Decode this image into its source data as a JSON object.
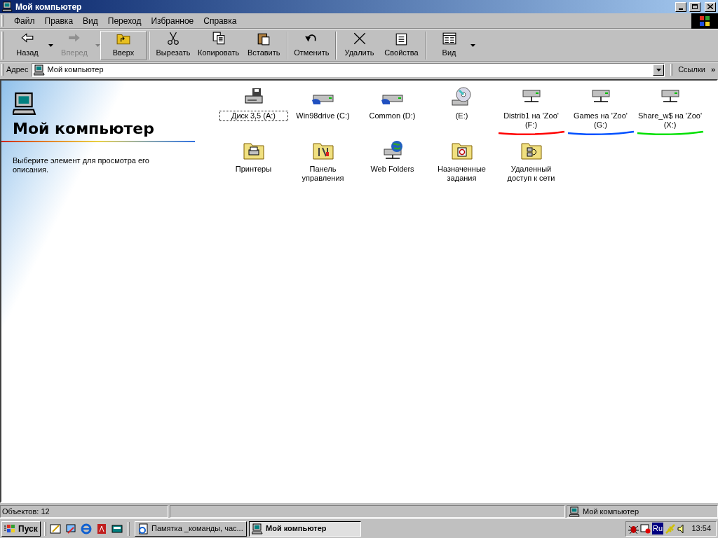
{
  "window": {
    "title": "Мой компьютер"
  },
  "menu": [
    "Файл",
    "Правка",
    "Вид",
    "Переход",
    "Избранное",
    "Справка"
  ],
  "toolbar": [
    {
      "kind": "button",
      "label": "Назад",
      "disabled": false,
      "raised": false,
      "dropdown": true
    },
    {
      "kind": "button",
      "label": "Вперед",
      "disabled": true,
      "raised": false,
      "dropdown": true
    },
    {
      "kind": "button",
      "label": "Вверх",
      "disabled": false,
      "raised": true,
      "dropdown": false
    },
    {
      "kind": "separator"
    },
    {
      "kind": "button",
      "label": "Вырезать",
      "disabled": false,
      "raised": false,
      "dropdown": false
    },
    {
      "kind": "button",
      "label": "Копировать",
      "disabled": false,
      "raised": false,
      "dropdown": false
    },
    {
      "kind": "button",
      "label": "Вставить",
      "disabled": false,
      "raised": false,
      "dropdown": false
    },
    {
      "kind": "separator"
    },
    {
      "kind": "button",
      "label": "Отменить",
      "disabled": false,
      "raised": false,
      "dropdown": false
    },
    {
      "kind": "separator"
    },
    {
      "kind": "button",
      "label": "Удалить",
      "disabled": false,
      "raised": false,
      "dropdown": false
    },
    {
      "kind": "button",
      "label": "Свойства",
      "disabled": false,
      "raised": false,
      "dropdown": false
    },
    {
      "kind": "separator"
    },
    {
      "kind": "button",
      "label": "Вид",
      "disabled": false,
      "raised": false,
      "dropdown": true
    }
  ],
  "address": {
    "label": "Адрес",
    "value": "Мой компьютер",
    "links": "Ссылки",
    "chevron": "»"
  },
  "info_pane": {
    "title": "Мой компьютер",
    "description": "Выберите элемент для просмотра его описания."
  },
  "items": [
    {
      "kind": "floppy",
      "label": "Диск 3,5 (A:)",
      "focused": true
    },
    {
      "kind": "shared-drive",
      "label": "Win98drive (C:)",
      "focused": false
    },
    {
      "kind": "shared-drive",
      "label": "Common (D:)",
      "focused": false
    },
    {
      "kind": "cd",
      "label": "(E:)",
      "focused": false
    },
    {
      "kind": "network-drive",
      "label": "Distrib1 на 'Zoo' (F:)",
      "focused": false,
      "color": "#ff0000"
    },
    {
      "kind": "network-drive",
      "label": "Games на 'Zoo' (G:)",
      "focused": false,
      "color": "#0050ff"
    },
    {
      "kind": "network-drive",
      "label": "Share_w$ на 'Zoo' (X:)",
      "focused": false,
      "color": "#00e000"
    },
    {
      "kind": "printer-folder",
      "label": "Принтеры",
      "focused": false
    },
    {
      "kind": "tools-folder",
      "label": "Панель управления",
      "focused": false
    },
    {
      "kind": "web-folder",
      "label": "Web Folders",
      "focused": false
    },
    {
      "kind": "tasks-folder",
      "label": "Назначенные задания",
      "focused": false
    },
    {
      "kind": "dialup-folder",
      "label": "Удаленный доступ к сети",
      "focused": false
    }
  ],
  "status_bar": {
    "count": "Объектов: 12",
    "zone": "Мой компьютер"
  },
  "taskbar": {
    "start": "Пуск",
    "tasks": [
      {
        "label": "Памятка _команды, час...",
        "selected": false
      },
      {
        "label": "Мой компьютер",
        "selected": true
      }
    ],
    "tray": {
      "language": "Ru",
      "clock": "13:54"
    }
  }
}
